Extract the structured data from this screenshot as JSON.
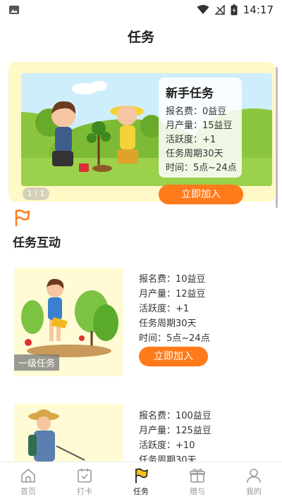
{
  "status_bar": {
    "time": "14:17"
  },
  "page": {
    "title": "任务"
  },
  "banner": {
    "card_title": "新手任务",
    "lines": [
      "报名费：0益豆",
      "月产量：15益豆",
      "活跃度：+1",
      "任务周期30天",
      "时间：5点~24点"
    ],
    "join_label": "立即加入",
    "pager": "1 / 1"
  },
  "section": {
    "title": "任务互动"
  },
  "tasks": [
    {
      "level": "一级任务",
      "lines": [
        "报名费：10益豆",
        "月产量：12益豆",
        "活跃度：+1",
        "任务周期30天",
        "时间：5点~24点"
      ],
      "join_label": "立即加入"
    },
    {
      "lines": [
        "报名费：100益豆",
        "月产量：125益豆",
        "活跃度：+10",
        "任务周期30天"
      ]
    }
  ],
  "tabbar": {
    "items": [
      {
        "label": "首页",
        "icon": "home-icon"
      },
      {
        "label": "打卡",
        "icon": "checkin-icon"
      },
      {
        "label": "任务",
        "icon": "flag-icon",
        "active": true
      },
      {
        "label": "赠与",
        "icon": "gift-icon"
      },
      {
        "label": "我的",
        "icon": "profile-icon"
      }
    ]
  },
  "colors": {
    "accent": "#ff7a1a",
    "banner_bg": "#fff8c7",
    "card_bg": "#fffbd4"
  }
}
